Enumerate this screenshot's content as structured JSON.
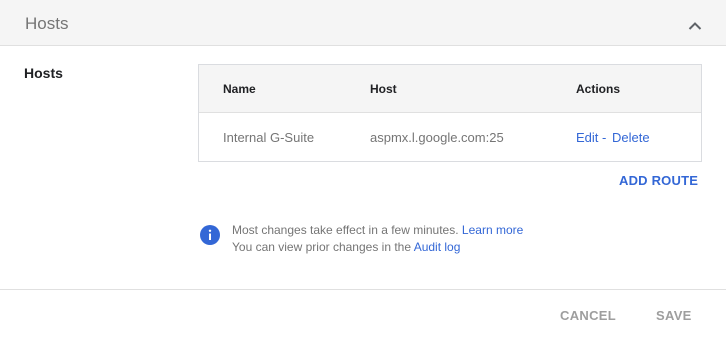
{
  "header": {
    "title": "Hosts",
    "collapse_icon": "chevron-up-icon"
  },
  "section": {
    "label": "Hosts"
  },
  "table": {
    "columns": [
      "Name",
      "Host",
      "Actions"
    ],
    "rows": [
      {
        "name": "Internal G-Suite",
        "host": "aspmx.l.google.com:25",
        "actions": {
          "edit": "Edit",
          "separator": "-",
          "delete": "Delete"
        }
      }
    ]
  },
  "add_route_label": "ADD ROUTE",
  "info": {
    "icon": "info-icon",
    "line1_text": "Most changes take effect in a few minutes.",
    "line1_link": "Learn more",
    "line2_text": "You can view prior changes in the",
    "line2_link": "Audit log"
  },
  "footer": {
    "cancel_label": "CANCEL",
    "save_label": "SAVE"
  },
  "colors": {
    "accent": "#3367d6",
    "muted_text": "#757575",
    "header_bg": "#f5f5f5",
    "disabled": "#9e9e9e"
  }
}
